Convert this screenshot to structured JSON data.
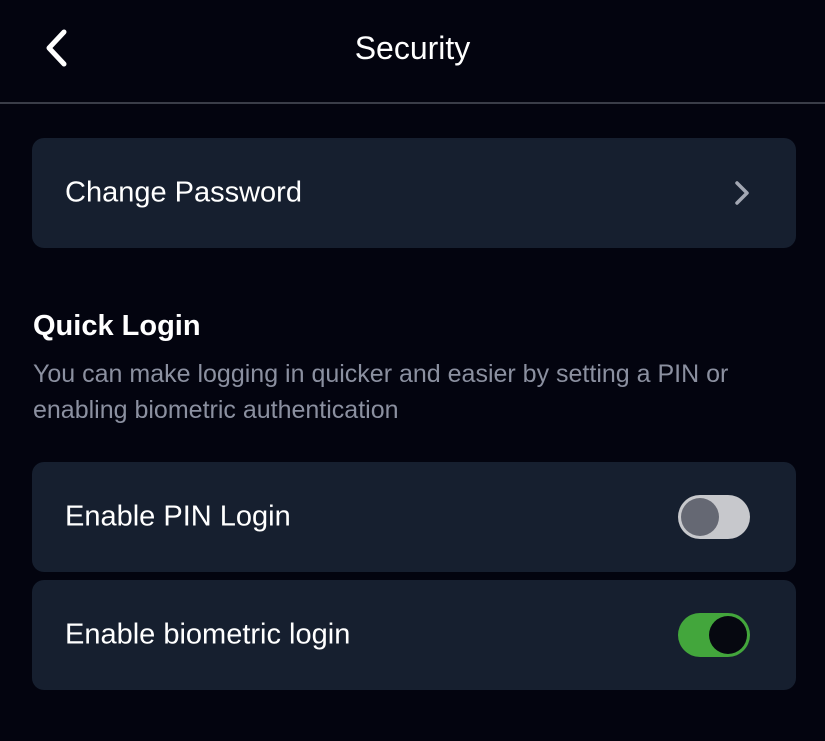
{
  "header": {
    "title": "Security",
    "back_icon": "chevron-left-icon"
  },
  "change_password": {
    "label": "Change Password",
    "icon": "chevron-right-icon"
  },
  "quick_login": {
    "title": "Quick Login",
    "description": "You can make logging in quicker and easier by setting a PIN or enabling biometric authentication"
  },
  "settings": [
    {
      "label": "Enable PIN Login",
      "enabled": false
    },
    {
      "label": "Enable biometric login",
      "enabled": true
    }
  ],
  "colors": {
    "background": "#03040f",
    "card": "#161f2f",
    "toggle_on": "#43a63c",
    "toggle_off": "#c7c8cc",
    "muted_text": "#8b90a0"
  }
}
